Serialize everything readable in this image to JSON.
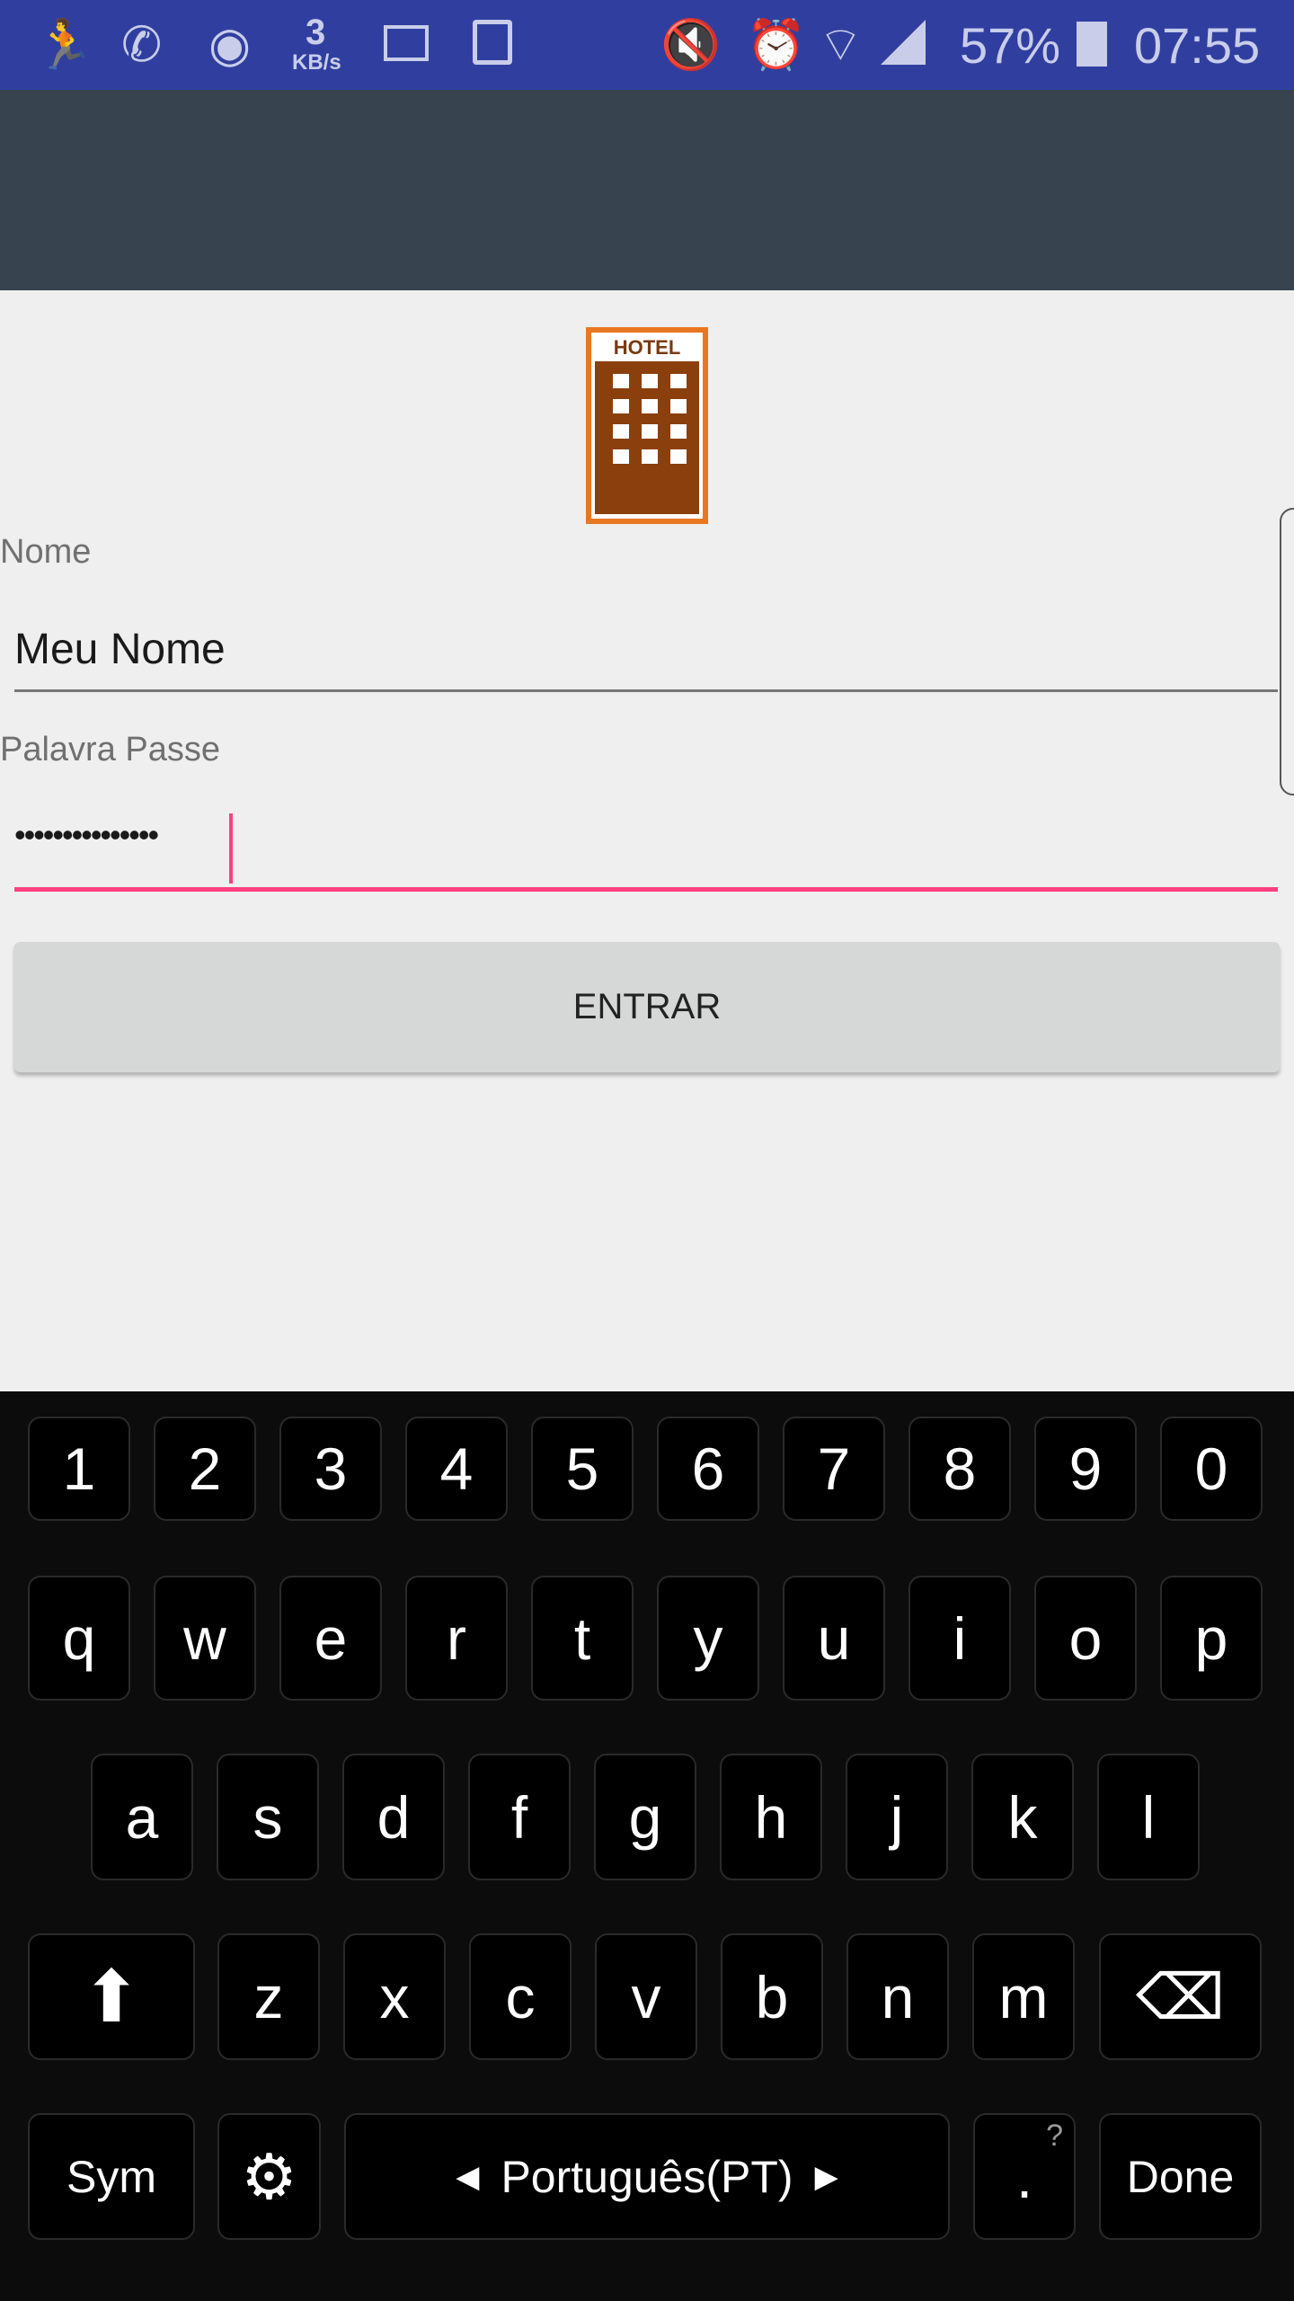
{
  "status_bar": {
    "kbs_value": "3",
    "kbs_unit": "KB/s",
    "battery": "57%",
    "time": "07:55",
    "icons": [
      "running-app-icon",
      "whatsapp-icon",
      "app-icon",
      "keyboard-icon",
      "image-icon",
      "mute-icon",
      "alarm-icon",
      "wifi-icon",
      "signal-icon",
      "battery-icon"
    ]
  },
  "logo": {
    "text": "HOTEL"
  },
  "form": {
    "name_label": "Nome",
    "name_value": "Meu Nome",
    "password_label": "Palavra Passe",
    "password_value": "•••••••••••••••",
    "submit_label": "ENTRAR"
  },
  "colors": {
    "status_bar": "#303f9f",
    "toolbar": "#37434f",
    "accent": "#ff4081",
    "button": "#d6d7d7"
  },
  "keyboard": {
    "row1": [
      "1",
      "2",
      "3",
      "4",
      "5",
      "6",
      "7",
      "8",
      "9",
      "0"
    ],
    "row2": [
      "q",
      "w",
      "e",
      "r",
      "t",
      "y",
      "u",
      "i",
      "o",
      "p"
    ],
    "row3": [
      "a",
      "s",
      "d",
      "f",
      "g",
      "h",
      "j",
      "k",
      "l"
    ],
    "row4": [
      "z",
      "x",
      "c",
      "v",
      "b",
      "n",
      "m"
    ],
    "sym_label": "Sym",
    "space_label": "Português(PT)",
    "period_label": ".",
    "period_hint": "?",
    "done_label": "Done"
  }
}
